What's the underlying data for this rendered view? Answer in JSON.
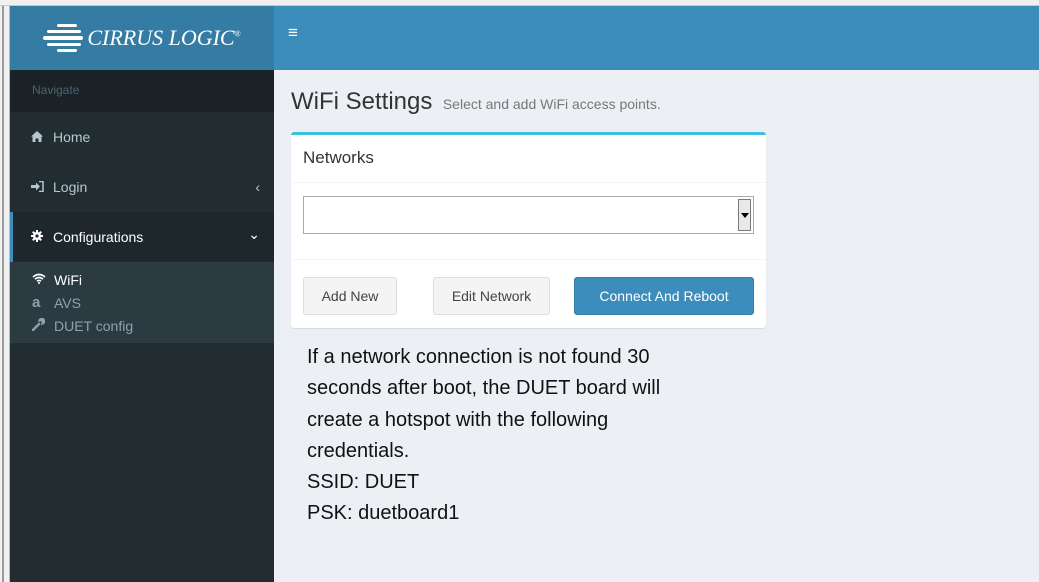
{
  "brand": {
    "name": "CIRRUS LOGIC",
    "mark": "®"
  },
  "topbar": {
    "menu_icon": "hamburger-icon"
  },
  "sidebar": {
    "header": "Navigate",
    "items": [
      {
        "label": "Home",
        "icon": "home-icon"
      },
      {
        "label": "Login",
        "icon": "login-icon",
        "caret": "‹"
      },
      {
        "label": "Configurations",
        "icon": "gear-icon",
        "caret": "⌄"
      }
    ],
    "subitems": [
      {
        "label": "WiFi",
        "icon": "wifi-icon"
      },
      {
        "label": "AVS",
        "icon": "amazon-icon"
      },
      {
        "label": "DUET config",
        "icon": "wrench-icon"
      }
    ]
  },
  "page": {
    "title": "WiFi Settings",
    "subtitle": "Select and add WiFi access points."
  },
  "networks": {
    "title": "Networks",
    "select_value": "",
    "buttons": {
      "add": "Add New",
      "edit": "Edit Network",
      "connect": "Connect And Reboot"
    }
  },
  "info": {
    "lines": [
      "If a network connection is not found 30",
      "seconds after boot, the DUET board will",
      "create a hotspot with the following",
      "credentials."
    ],
    "ssid": "SSID: DUET",
    "psk": "PSK: duetboard1"
  },
  "colors": {
    "header": "#3c8dbc",
    "logo_bg": "#357ca5",
    "sidebar": "#222d32",
    "box_accent": "#3cc0e0",
    "primary": "#3c8dbc"
  }
}
